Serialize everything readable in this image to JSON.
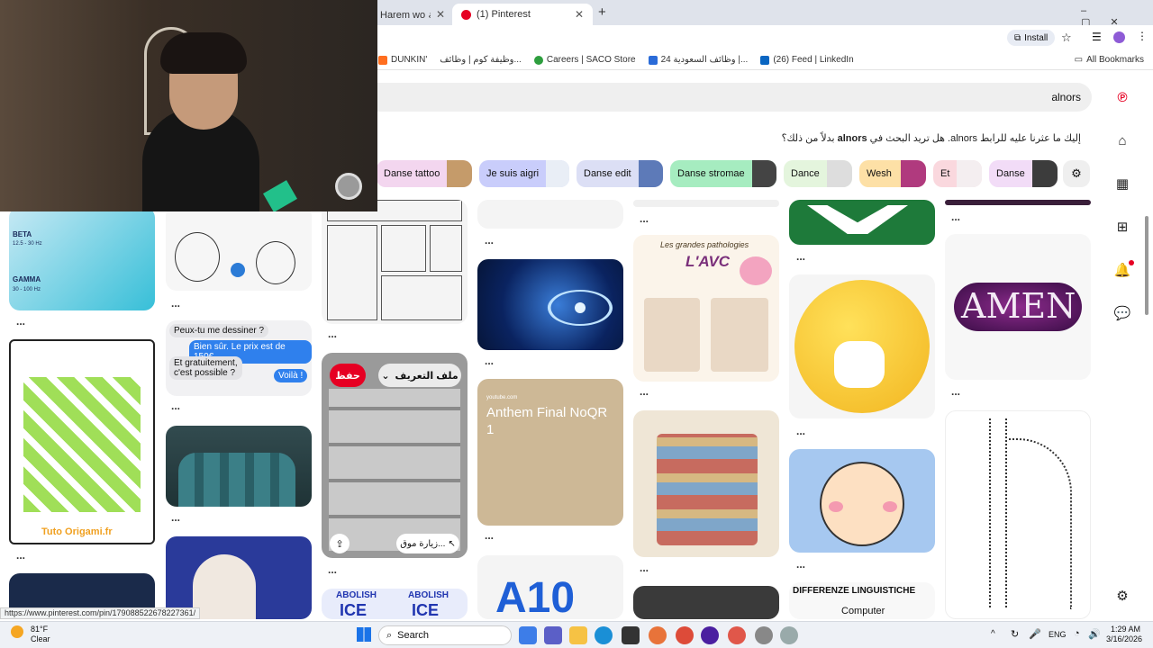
{
  "browser": {
    "tabs": [
      {
        "label": "Harem wo قمبلة"
      },
      {
        "label": "(1) Pinterest"
      }
    ],
    "new_tab": "+",
    "install_label": "Install",
    "bookmarks": [
      {
        "label": "DUNKIN'"
      },
      {
        "label": "وظيفة كوم | وظائف..."
      },
      {
        "label": "Careers | SACO Store"
      },
      {
        "label": "وظائف السعودية 24 |..."
      },
      {
        "label": "(26) Feed | LinkedIn"
      }
    ],
    "all_bookmarks": "All Bookmarks",
    "status_url": "https://www.pinterest.com/pin/1790885226782273​61/"
  },
  "pinterest": {
    "search_value": "alnors",
    "suggestion_prefix": "إليك ما عثرنا عليه للرابط alnors. هل تريد البحث في",
    "suggestion_term": "alnors",
    "suggestion_suffix": "بدلاً من ذلك؟",
    "chips": [
      {
        "label": "Danse tattoo",
        "color": "#f3d6ef"
      },
      {
        "label": "Je suis aigri",
        "color": "#c9cdfb"
      },
      {
        "label": "Danse edit",
        "color": "#dcdff5"
      },
      {
        "label": "Danse stromae",
        "color": "#a6ecc0"
      },
      {
        "label": "Dance",
        "color": "#e4f5dd"
      },
      {
        "label": "Wesh",
        "color": "#fde0a6"
      },
      {
        "label": "Et",
        "color": "#fad8de"
      },
      {
        "label": "Danse",
        "color": "#f2dcf7"
      }
    ],
    "hover_pin": {
      "save": "حفظ",
      "profile": "ملف التعريف",
      "visit": "زيارة موق...",
      "share_icon": "share-icon"
    },
    "pins": {
      "brainwaves_beta": "BETA",
      "brainwaves_beta_range": "12.5 - 30 Hz",
      "brainwaves_gamma": "GAMMA",
      "brainwaves_gamma_range": "30 - 100 Hz",
      "chat_line1": "Peux-tu me dessiner ?",
      "chat_line2": "Bien sûr. Le prix est de 150€.",
      "chat_line3": "Et gratuitement,",
      "chat_line4": "c'est possible ?",
      "chat_line5": "Voilà !",
      "origami_label": "Tuto Origami.fr",
      "anthem_source": "youtube.com",
      "anthem_title": "Anthem Final NoQR 1",
      "avc_title1": "Les grandes pathologies",
      "avc_title2": "L'AVC",
      "amen_text": "AMEN",
      "abolish_text": "ABOLISH",
      "ice_text": "ICE",
      "a10_text": "A10",
      "differenze_title": "DIFFERENZE LINGUISTICHE",
      "differenze_word": "Computer"
    },
    "more_dots": "..."
  },
  "taskbar": {
    "weather_temp": "81°F",
    "weather_desc": "Clear",
    "search_label": "Search",
    "language": "ENG",
    "time": "1:29 AM",
    "date": "3/16/2026"
  },
  "colors": {
    "pinterest_red": "#e60023",
    "accent_blue": "#1a73e8"
  }
}
